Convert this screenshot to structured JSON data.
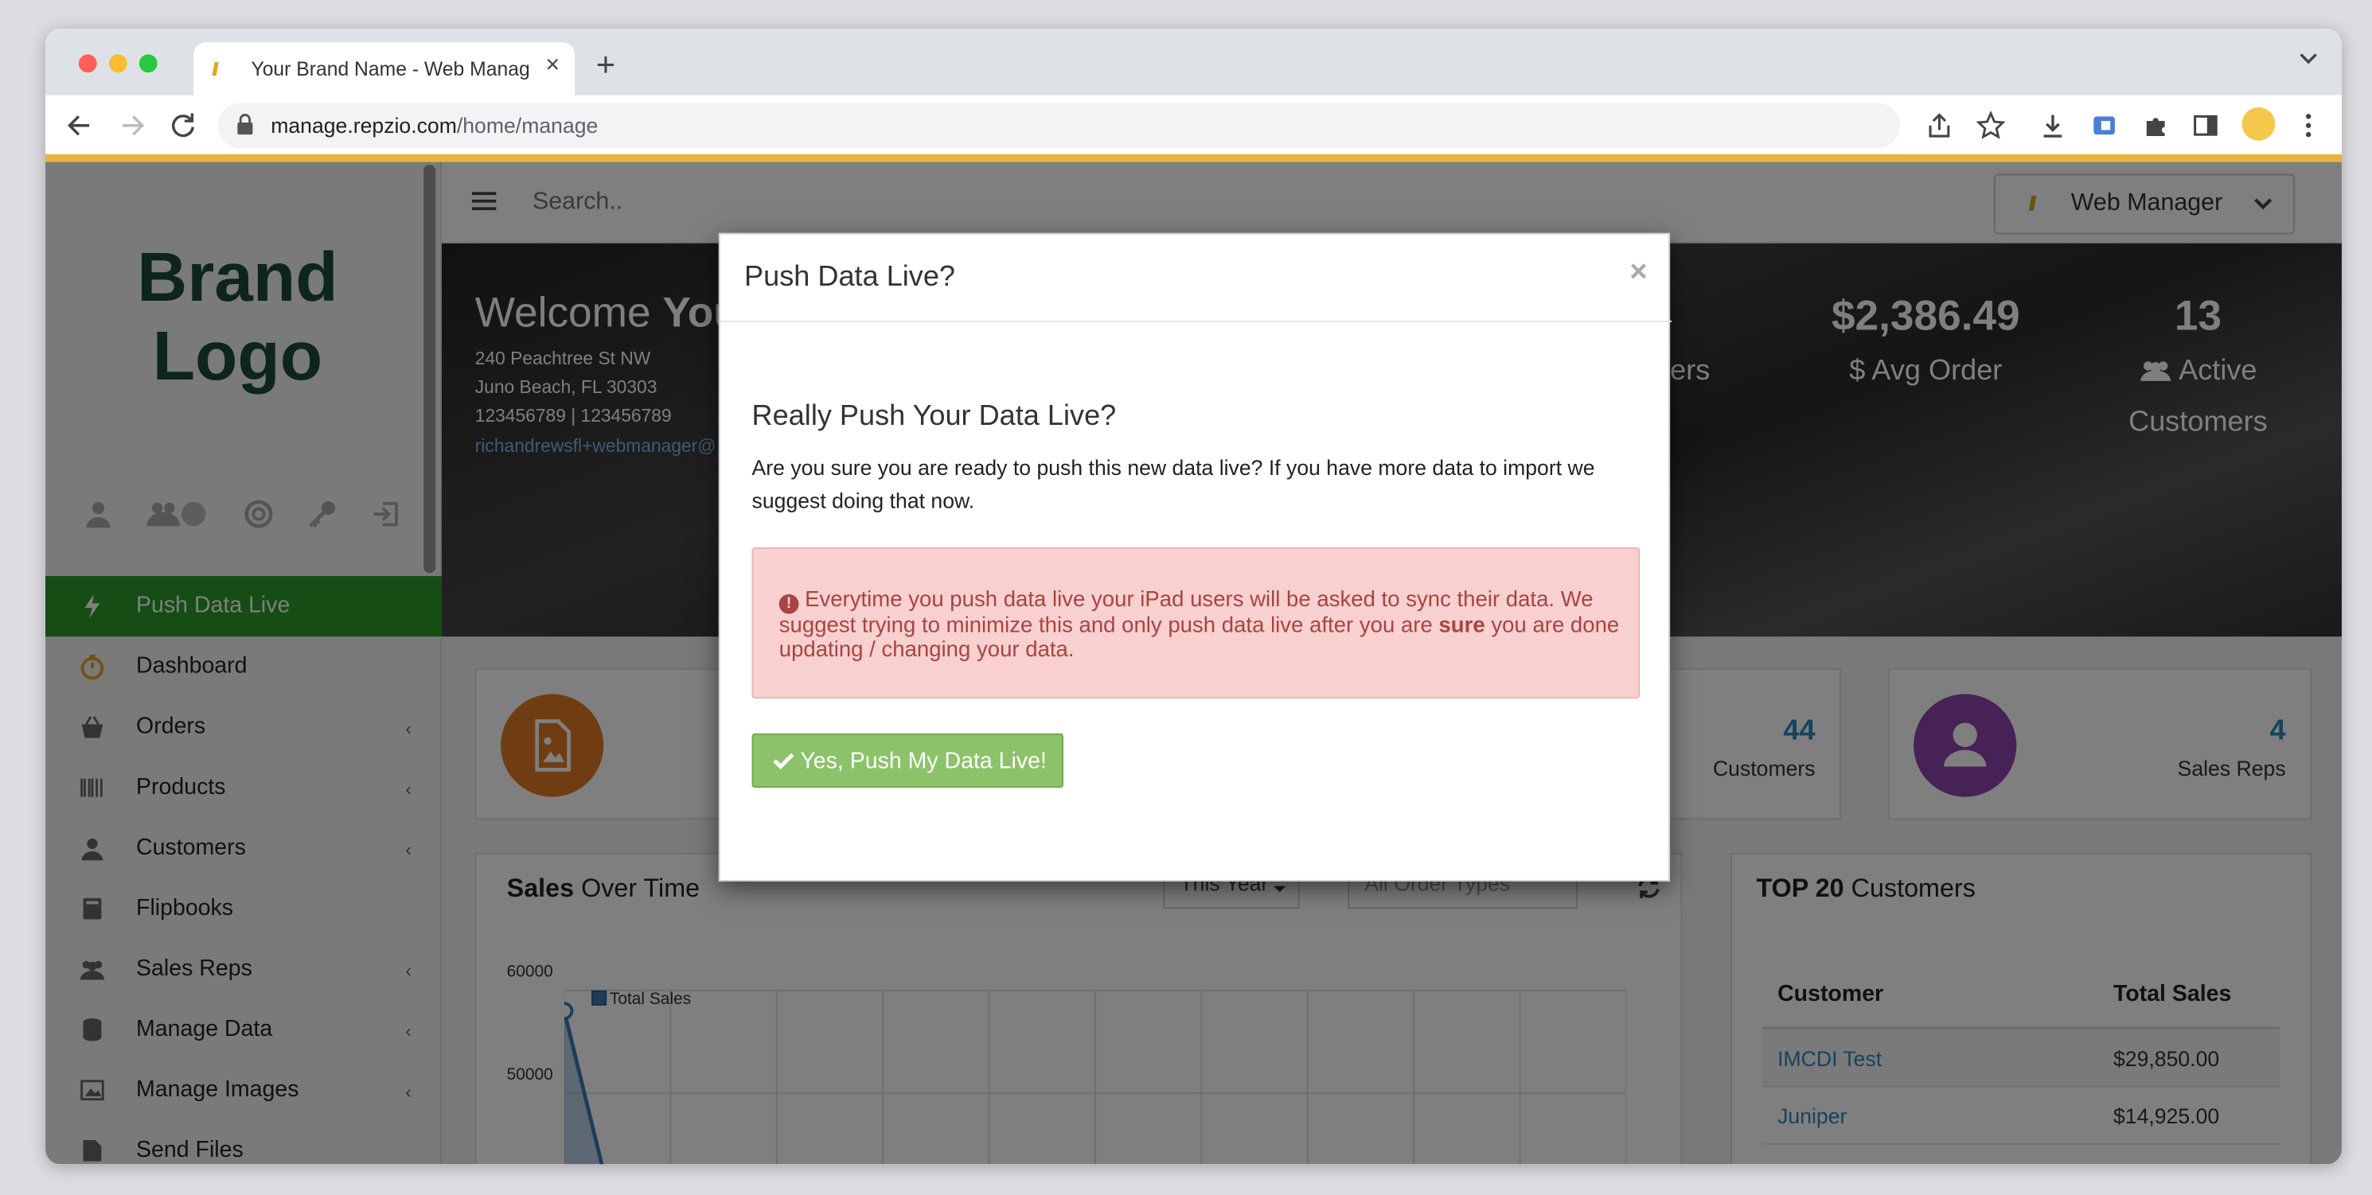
{
  "browser": {
    "tab_title": "Your Brand Name - Web Manager",
    "tab_close": "×",
    "new_tab": "+",
    "url_host": "manage.repzio.com",
    "url_path": "/home/manage"
  },
  "sidebar": {
    "logo_line1": "Brand",
    "logo_line2": "Logo",
    "user_badge_count": "",
    "items": [
      {
        "label": "Push Data Live",
        "icon": "bolt-icon",
        "active": true
      },
      {
        "label": "Dashboard",
        "icon": "stopwatch-icon"
      },
      {
        "label": "Orders",
        "icon": "basket-icon",
        "chevron": "‹"
      },
      {
        "label": "Products",
        "icon": "barcode-icon",
        "chevron": "‹"
      },
      {
        "label": "Customers",
        "icon": "user-icon",
        "chevron": "‹"
      },
      {
        "label": "Flipbooks",
        "icon": "book-icon"
      },
      {
        "label": "Sales Reps",
        "icon": "users-icon",
        "chevron": "‹"
      },
      {
        "label": "Manage Data",
        "icon": "database-icon",
        "chevron": "‹"
      },
      {
        "label": "Manage Images",
        "icon": "image-icon",
        "chevron": "‹"
      },
      {
        "label": "Send Files",
        "icon": "file-icon"
      }
    ]
  },
  "topbar": {
    "search_placeholder": "Search..",
    "web_manager_label": "Web Manager"
  },
  "hero": {
    "welcome": "Welcome",
    "welcome_name": "You",
    "address_line1": "240 Peachtree St NW",
    "address_line2": "Juno Beach, FL 30303",
    "phones": "123456789 | 123456789",
    "email": "richandrewsfl+webmanager@",
    "partial_label": "ers",
    "avg_order_value": "$2,386.49",
    "avg_order_label": "$ Avg Order",
    "active_customers_value": "13",
    "active_label_line1": "Active",
    "active_label_line2": "Customers"
  },
  "cards": {
    "customers_value": "44",
    "customers_label": "Customers",
    "sales_reps_value": "4",
    "sales_reps_label": "Sales Reps"
  },
  "sales_panel": {
    "title_bold": "Sales",
    "title_rest": "Over Time",
    "period_select": "This Year",
    "order_type_placeholder": "All Order Types",
    "legend": "Total Sales",
    "y_ticks": [
      "60000",
      "50000"
    ]
  },
  "chart_data": {
    "type": "area",
    "series": [
      {
        "name": "Total Sales",
        "values": [
          58000,
          40000
        ]
      }
    ],
    "y_ticks": [
      60000,
      50000
    ],
    "ylim": [
      40000,
      60000
    ],
    "grid": true
  },
  "top_customers": {
    "title_bold": "TOP 20",
    "title_rest": "Customers",
    "col_customer": "Customer",
    "col_total": "Total Sales",
    "rows": [
      {
        "customer": "IMCDI Test",
        "total": "$29,850.00"
      },
      {
        "customer": "Juniper",
        "total": "$14,925.00"
      }
    ]
  },
  "modal": {
    "title": "Push Data Live?",
    "close": "×",
    "heading": "Really Push Your Data Live?",
    "body": "Are you sure you are ready to push this new data live? If you have more data to import we suggest doing that now.",
    "alert_before": "Everytime you push data live your iPad users will be asked to sync their data. We suggest trying to minimize this and only push data live after you are",
    "alert_bold": "sure",
    "alert_after": "you are done updating / changing your data.",
    "confirm_label": "Yes, Push My Data Live!"
  },
  "colors": {
    "brand_yellow": "#e8b43c",
    "active_green": "#2b9b2b",
    "confirm_green": "#8cc26a",
    "alert_bg": "#f8d0cf",
    "alert_text": "#a94442",
    "link_blue": "#2e86c1",
    "orange_circle": "#e07b24",
    "purple_circle": "#8e44ad"
  }
}
